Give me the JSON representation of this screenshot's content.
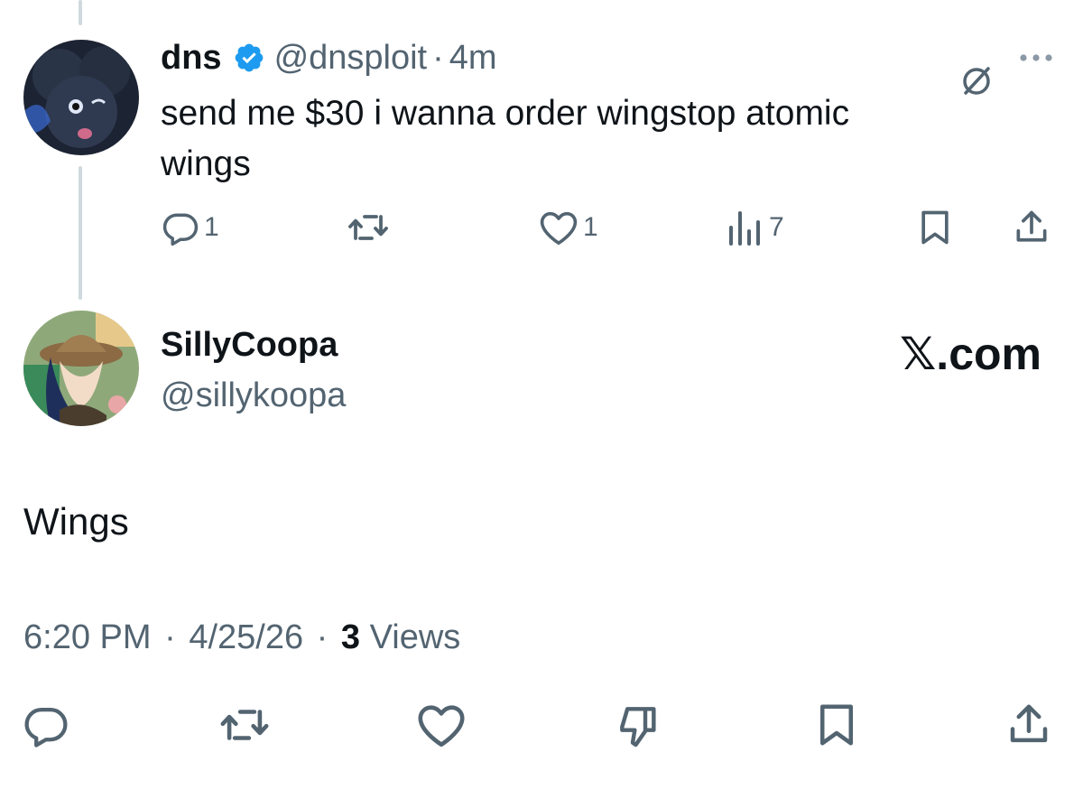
{
  "parent_tweet": {
    "display_name": "dns",
    "handle": "@dnsploit",
    "separator": "·",
    "time": "4m",
    "text_line1": "send me $30 i wanna order wingstop atomic",
    "text_line2": "wings",
    "replies": "1",
    "likes": "1",
    "views": "7",
    "icons": [
      "reply-icon",
      "retweet-icon",
      "like-icon",
      "views-icon",
      "bookmark-icon",
      "share-icon",
      "grok-icon",
      "more-icon",
      "verified-badge-icon"
    ]
  },
  "main_tweet": {
    "display_name": "SillyCoopa",
    "handle": "@sillykoopa",
    "text": "Wings",
    "time": "6:20 PM",
    "date": "4/25/26",
    "separator": "·",
    "views_count": "3",
    "views_label": "Views",
    "icons": [
      "reply-icon",
      "retweet-icon",
      "like-icon",
      "dislike-icon",
      "bookmark-icon",
      "share-icon"
    ]
  },
  "watermark": {
    "text": "𝕏.com"
  },
  "colors": {
    "text": "#0f1419",
    "muted": "#536471",
    "verified": "#1d9bf0",
    "thread_line": "#cfd9de"
  }
}
